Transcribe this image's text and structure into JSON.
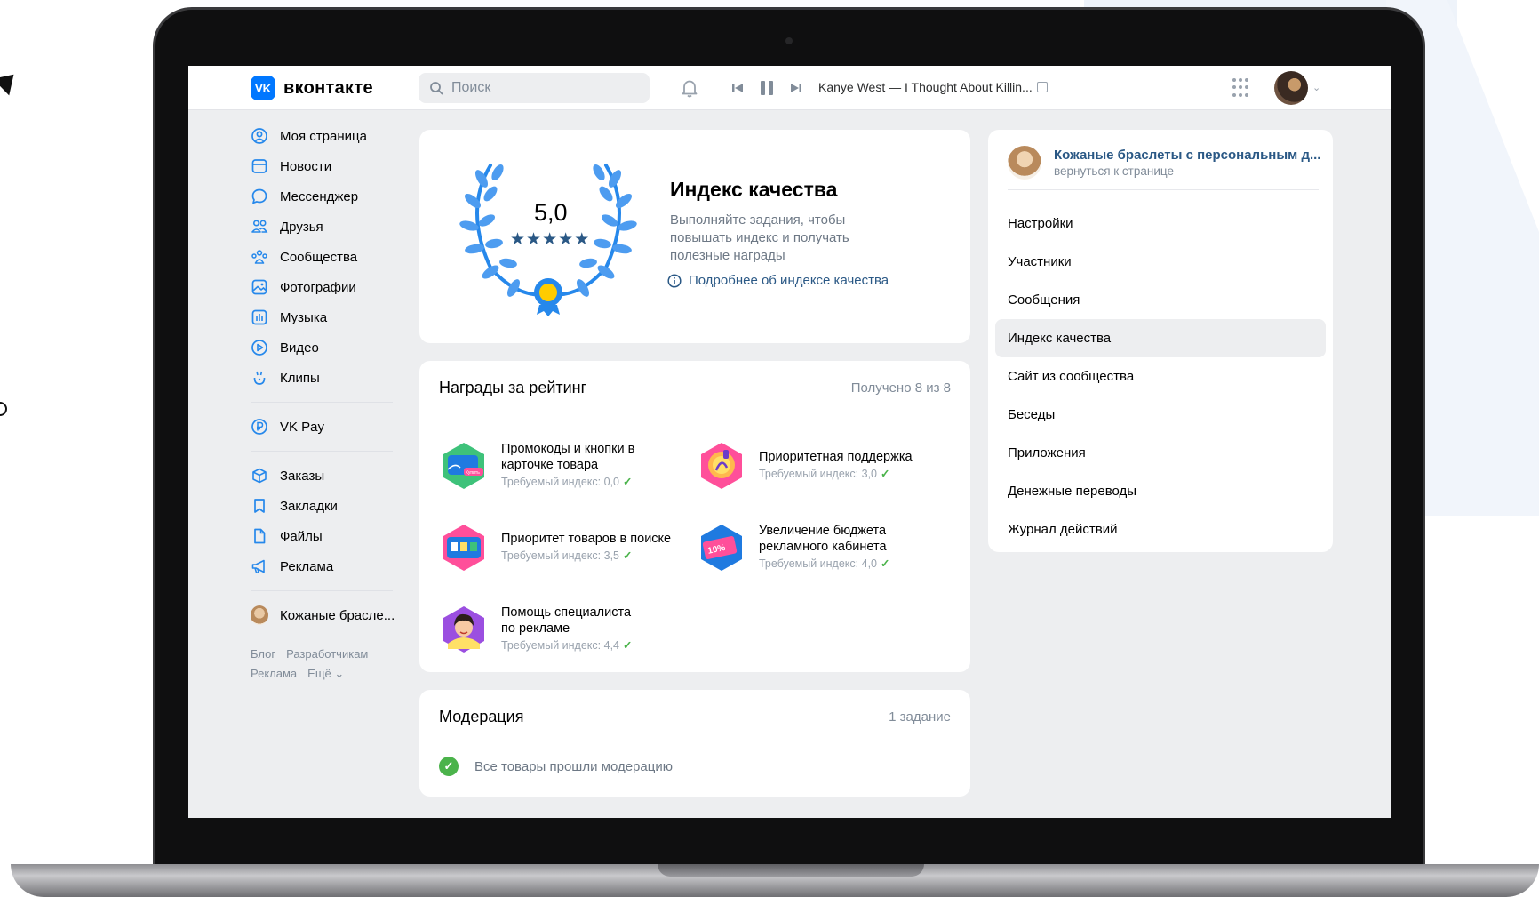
{
  "header": {
    "logo_text": "вконтакте",
    "logo_mark": "VK",
    "search_placeholder": "Поиск",
    "now_playing": "Kanye West — I Thought About Killin..."
  },
  "nav": {
    "items": [
      {
        "label": "Моя страница",
        "icon": "user-circle-icon"
      },
      {
        "label": "Новости",
        "icon": "newspaper-icon"
      },
      {
        "label": "Мессенджер",
        "icon": "message-icon"
      },
      {
        "label": "Друзья",
        "icon": "friends-icon"
      },
      {
        "label": "Сообщества",
        "icon": "communities-icon"
      },
      {
        "label": "Фотографии",
        "icon": "photo-icon"
      },
      {
        "label": "Музыка",
        "icon": "music-icon"
      },
      {
        "label": "Видео",
        "icon": "video-icon"
      },
      {
        "label": "Клипы",
        "icon": "clips-icon"
      }
    ],
    "vkpay": "VK Pay",
    "items2": [
      {
        "label": "Заказы",
        "icon": "box-icon"
      },
      {
        "label": "Закладки",
        "icon": "bookmark-icon"
      },
      {
        "label": "Файлы",
        "icon": "file-icon"
      },
      {
        "label": "Реклама",
        "icon": "megaphone-icon"
      }
    ],
    "community": "Кожаные брасле...",
    "footer": [
      "Блог",
      "Разработчикам",
      "Реклама",
      "Ещё ⌄"
    ]
  },
  "quality": {
    "score": "5,0",
    "title": "Индекс качества",
    "description": "Выполняйте задания, чтобы повышать индекс и получать полезные награды",
    "link": "Подробнее об индексе качества",
    "stars": 5
  },
  "rewards": {
    "title": "Награды за рейтинг",
    "count": "Получено 8 из 8",
    "items": [
      {
        "title": "Промокоды и кнопки в карточке товара",
        "req": "Требуемый индекс: 0,0"
      },
      {
        "title": "Приоритетная поддержка",
        "req": "Требуемый индекс: 3,0"
      },
      {
        "title": "Приоритет товаров в поиске",
        "req": "Требуемый индекс: 3,5"
      },
      {
        "title": "Увеличение бюджета рекламного кабинета",
        "req": "Требуемый индекс: 4,0"
      },
      {
        "title": "Помощь специалиста по рекламе",
        "req": "Требуемый индекс: 4,4"
      }
    ],
    "badge_text_1": "Купить",
    "badge_text_4": "10%"
  },
  "moderation": {
    "title": "Модерация",
    "count": "1 задание",
    "status": "Все товары прошли модерацию"
  },
  "menu": {
    "community_name": "Кожаные браслеты с персональным д...",
    "back": "вернуться к странице",
    "items": [
      "Настройки",
      "Участники",
      "Сообщения",
      "Индекс качества",
      "Сайт из сообщества",
      "Беседы",
      "Приложения",
      "Денежные переводы",
      "Журнал действий"
    ],
    "active_index": 3
  },
  "colors": {
    "accent": "#0077ff",
    "link": "#2a5885",
    "success": "#4bb34b"
  }
}
